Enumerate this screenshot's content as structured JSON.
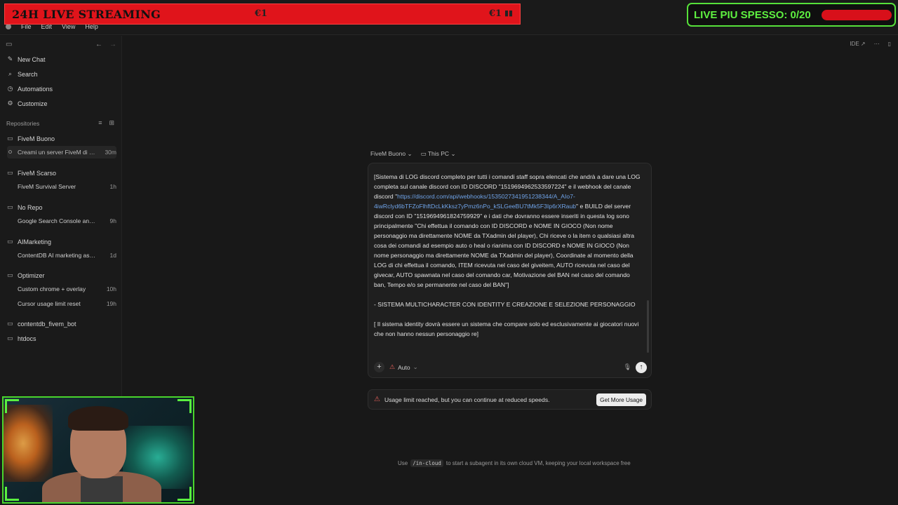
{
  "overlay": {
    "stream_title": "24H LIVE STREAMING",
    "coin_left": "€1",
    "coin_right": "€1",
    "live_label": "LIVE PIU SPESSO: 0/20",
    "live_progress": 0
  },
  "menu": {
    "items": [
      "File",
      "Edit",
      "View",
      "Help"
    ]
  },
  "sidebar": {
    "nav": [
      {
        "label": "New Chat",
        "icon": "new-chat-icon"
      },
      {
        "label": "Search",
        "icon": "search-icon"
      },
      {
        "label": "Automations",
        "icon": "clock-icon"
      },
      {
        "label": "Customize",
        "icon": "sliders-icon"
      }
    ],
    "repositories_label": "Repositories",
    "repos": [
      {
        "name": "FiveM Buono",
        "chats": [
          {
            "name": "Creami un server FiveM di no...",
            "time": "30m",
            "active": true
          }
        ]
      },
      {
        "name": "FiveM Scarso",
        "chats": [
          {
            "name": "FiveM Survival Server",
            "time": "1h"
          }
        ]
      },
      {
        "name": "No Repo",
        "chats": [
          {
            "name": "Google Search Console analy...",
            "time": "9h"
          }
        ]
      },
      {
        "name": "AIMarketing",
        "chats": [
          {
            "name": "ContentDB AI marketing assi...",
            "time": "1d"
          }
        ]
      },
      {
        "name": "Optimizer",
        "chats": [
          {
            "name": "Custom chrome + overlay",
            "time": "10h"
          },
          {
            "name": "Cursor usage limit reset",
            "time": "19h"
          }
        ]
      },
      {
        "name": "contentdb_fivem_bot",
        "chats": []
      },
      {
        "name": "htdocs",
        "chats": []
      }
    ]
  },
  "main": {
    "ide_label": "IDE ↗",
    "selectors": {
      "project": "FiveM Buono",
      "location": "This PC"
    },
    "prompt": {
      "part1": "[Sistema di LOG discord completo per tutti i comandi staff sopra elencati che andrà a dare una LOG completa sul canale discord con ID DISCORD \"1519694962533597224\" e il webhook del canale discord \"",
      "link": "https://discord.com/api/webhooks/1535027341951238344/A_AIo7-4iwRclyd6bTFZoFlhftDcLkKksz7yPmz6nPo_kSLGeeBU7tMk5F3Ip6rXRaub",
      "part2": "\" e BUILD del server discord con ID \"1519694961824759929\" e i dati che dovranno essere inseriti in questa log sono principalmente \"Chi effettua il comando con ID DISCORD e NOME IN GIOCO (Non nome personaggio ma direttamente NOME da TXadmin del player), Chi riceve o la item o qualsiasi altra cosa dei comandi ad esempio auto o heal o rianima con ID DISCORD e NOME IN GIOCO (Non nome personaggio ma direttamente NOME da TXadmin del player), Coordinate al momento della LOG di chi effettua il comando, ITEM ricevuta nel caso del giveitem, AUTO ricevuta nel caso del givecar, AUTO spawnata nel caso del comando car, Motivazione del BAN nel caso del comando ban, Tempo e/o se permanente nel caso del BAN\"]\n\n- SISTEMA MULTICHARACTER CON IDENTITY E CREAZIONE E SELEZIONE PERSONAGGIO\n\n[ Il sistema identity dovrà essere un sistema che compare solo ed esclusivamente ai giocatori nuovi che non hanno nessun personaggio re]"
    },
    "mode_label": "Auto",
    "usage": {
      "message": "Usage limit reached, but you can continue at reduced speeds.",
      "button": "Get More Usage"
    },
    "hint": {
      "pre": "Use",
      "code": "/in-cloud",
      "post": "to start a subagent in its own cloud VM, keeping your local workspace free"
    }
  }
}
